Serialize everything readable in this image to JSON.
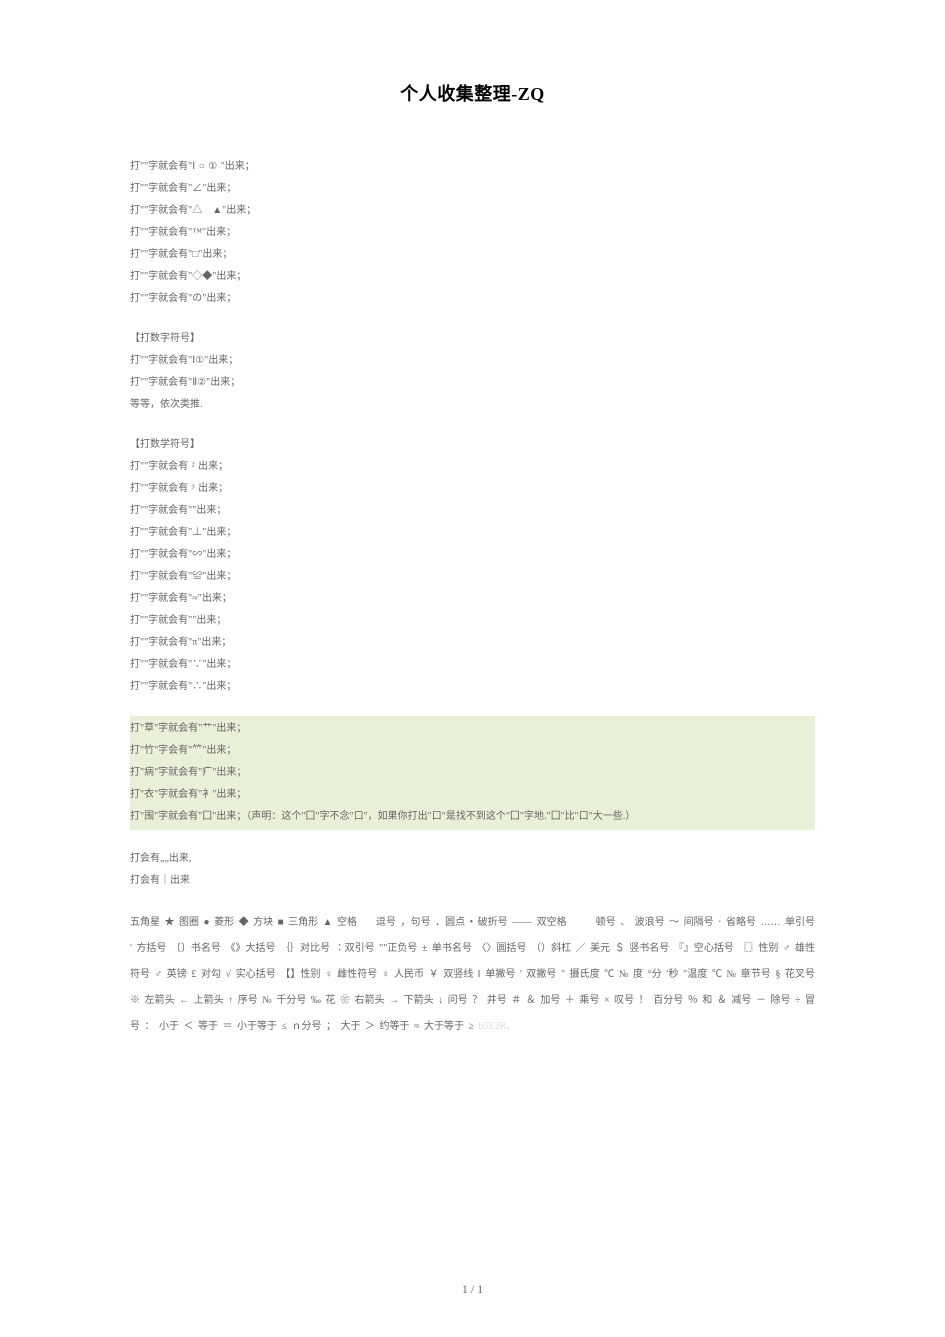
{
  "title": "个人收集整理-ZQ",
  "block1": {
    "lines": [
      "打\"\"字就会有\"Ⅰ ○ ① \"出来；",
      "打\"\"字就会有\"∠\"出来；",
      "打\"\"字就会有\"△　▲\"出来；",
      "打\"\"字就会有\"™\"出来；",
      "打\"\"字就会有\"□\"出来；",
      "打\"\"字就会有\"◇◆\"出来；",
      "打\"\"字就会有\"の\"出来；"
    ]
  },
  "block2": {
    "heading": "【打数字符号】",
    "lines": [
      "打\"\"字就会有\"Ⅰ①\"出来；",
      "打\"\"字就会有\"Ⅱ②\"出来；",
      "等等，依次类推."
    ]
  },
  "block3": {
    "heading": "【打数学符号】",
    "lines": [
      "打\"\"字就会有 ² 出来；",
      "打\"\"字就会有 ³ 出来；",
      "打\"\"字就会有\"\"出来；",
      "打\"\"字就会有\"⊥\"出来；",
      "打\"\"字就会有\"∽\"出来；",
      "打\"\"字就会有\"≌\"出来；",
      "打\"\"字就会有\"≈\"出来；",
      "打\"\"字就会有\"\"出来；",
      "打\"\"字就会有\"π\"出来；",
      "打\"\"字就会有\"∵\"出来；",
      "打\"\"字就会有\"∴\"出来；"
    ]
  },
  "block4_highlighted": {
    "lines": [
      "打\"草\"字就会有\"艹\"出来；",
      "打\"竹\"字会有\"⺮\"出来；",
      "打\"病\"字就会有\"疒\"出来；",
      "打\"衣\"字就会有\"衤\"出来；",
      "打\"围\"字就会有\"囗\"出来；（声明：这个\"囗\"字不念\"口\"，如果你打出\"口\"是找不到这个\"囗\"字地.\"囗\"比\"口\"大一些.）"
    ]
  },
  "block5": {
    "lines": [
      "打会有„„出来,",
      "打会有｜出来"
    ]
  },
  "symbols_paragraph": "五角星 ★ 图圈 ● 菱形 ◆ 方块 ■ 三角形 ▲ 空格 　 逗号 ，句号 ．圆点 • 破折号 —— 双空格 　　 顿号 、 波浪号 ～ 间隔号 · 省略号 …… 单引号 ' 方括号 〔〕书名号 《》大括号 ｛｝对比号 ∶双引号 \"\"正负号 ± 单书名号 〈〉圆括号 （）斜杠 ／ 美元 ＄ 竖书名号 『』空心括号 〖〗性别 ♂ 雄性符号 ♂ 英镑 £ 对勾 √ 实心括号 【】性别 ♀ 雌性符号 ♀ 人民币 ￥ 双竖线 ‖ 单撇号 ' 双撇号 \" 摄氏度 ℃ № 度 °分 ′秒 ″温度 ℃ № 章节号 § 花叉号 ※ 左箭头 ← 上箭头 ↑ 序号 № 千分号 ‰ 花 ❀ 右箭头 → 下箭头 ↓ 问号 ？ 井号 ＃ ＆ 加号 ＋ 乘号 × 叹号 ！ 百分号 ％ 和 ＆ 减号 － 除号 ÷ 冒号 ： 小于 ＜ 等于 ＝ 小于等于 ≤ ｎ分号 ； 大于 ＞ 约等于 ≈ 大于等于 ≥",
  "symbols_trailing": "b5E2R。",
  "page_number": "1 / 1"
}
